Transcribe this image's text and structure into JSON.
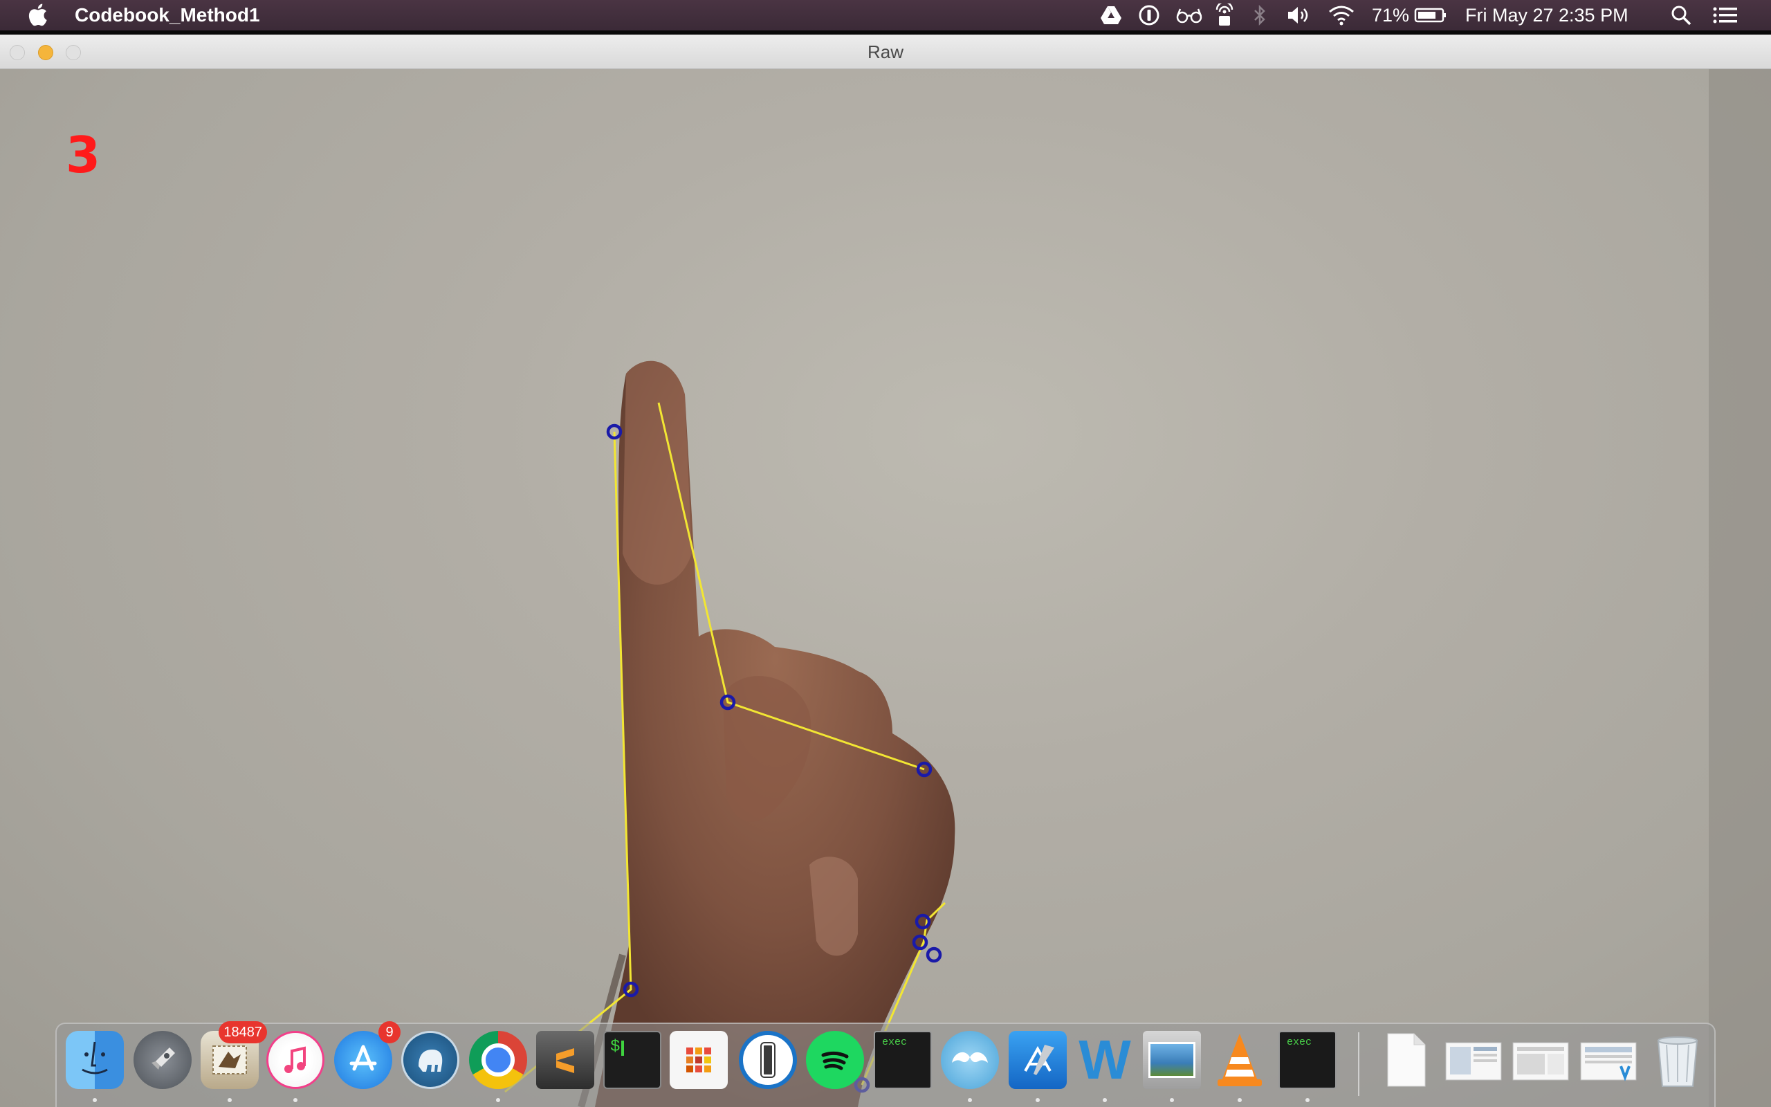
{
  "menubar": {
    "app_name": "Codebook_Method1",
    "battery_percent": "71%",
    "datetime": "Fri May 27  2:35 PM",
    "status_icons": [
      "google-drive-icon",
      "1password-mini-icon",
      "accessibility-glasses-icon",
      "airport-lock-icon",
      "bluetooth-icon",
      "volume-icon",
      "wifi-icon",
      "battery-icon",
      "spotlight-search-icon",
      "notification-center-icon"
    ]
  },
  "window": {
    "title": "Raw",
    "finger_count": "3",
    "colors": {
      "hull_line": "#f2e633",
      "defect_marker": "#1a1aa8",
      "count_text": "#ff1a1a"
    }
  },
  "dock": {
    "apps": [
      {
        "name": "finder-icon",
        "running": true
      },
      {
        "name": "launchpad-icon",
        "running": false
      },
      {
        "name": "mail-icon",
        "badge": "18487",
        "running": true
      },
      {
        "name": "itunes-icon",
        "running": true
      },
      {
        "name": "app-store-icon",
        "badge": "9",
        "running": false
      },
      {
        "name": "sequel-pro-icon",
        "running": false
      },
      {
        "name": "chrome-icon",
        "running": true
      },
      {
        "name": "sublime-text-icon",
        "running": false
      },
      {
        "name": "terminal-icon",
        "running": false
      },
      {
        "name": "launchpad-grid-icon",
        "running": false
      },
      {
        "name": "1password-icon",
        "running": false
      },
      {
        "name": "spotify-icon",
        "running": false
      },
      {
        "name": "exec-icon",
        "label": "exec",
        "running": false
      },
      {
        "name": "mustache-app-icon",
        "running": true
      },
      {
        "name": "xcode-icon",
        "running": true
      },
      {
        "name": "word-icon",
        "running": true
      },
      {
        "name": "preview-icon",
        "running": true
      },
      {
        "name": "vlc-icon",
        "running": true
      },
      {
        "name": "exec-icon",
        "label": "exec",
        "running": true
      }
    ],
    "docs": [
      "document-icon",
      "screenshot-stack-icon",
      "screenshot-stack-icon",
      "screenshot-stack-icon",
      "trash-icon"
    ]
  }
}
